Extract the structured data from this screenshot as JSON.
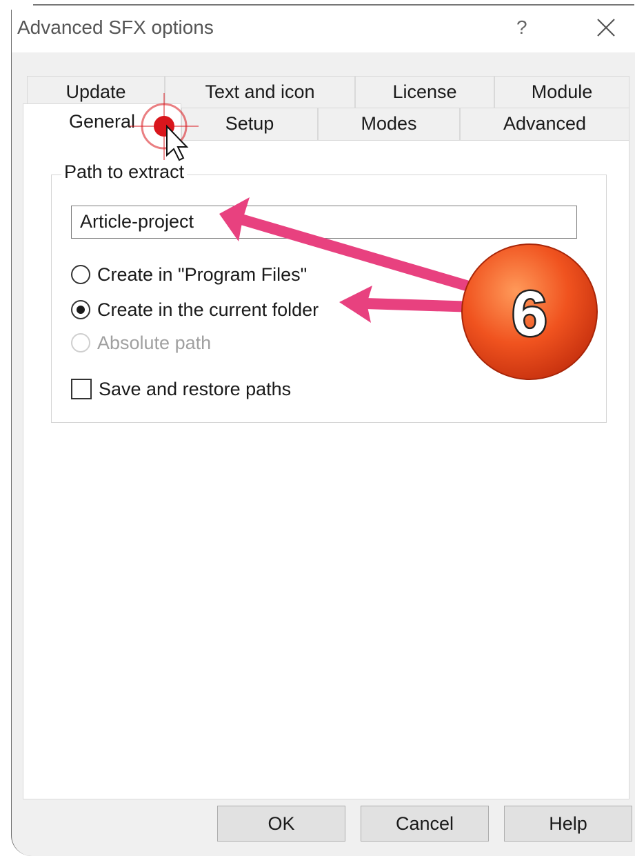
{
  "window": {
    "title": "Advanced SFX options",
    "help_label": "?",
    "close_icon": "close-icon"
  },
  "tabs": {
    "row1": [
      "Update",
      "Text and icon",
      "License",
      "Module"
    ],
    "row2": [
      "General",
      "Setup",
      "Modes",
      "Advanced"
    ],
    "active": "General"
  },
  "path_group": {
    "title": "Path to extract",
    "path_value": "Article-project",
    "options": [
      {
        "label": "Create in \"Program Files\"",
        "checked": false,
        "disabled": false
      },
      {
        "label": "Create in the current folder",
        "checked": true,
        "disabled": false
      },
      {
        "label": "Absolute path",
        "checked": false,
        "disabled": true
      }
    ],
    "save_restore_label": "Save and restore paths",
    "save_restore_checked": false
  },
  "buttons": {
    "ok": "OK",
    "cancel": "Cancel",
    "help": "Help"
  },
  "annotation": {
    "step_number": "6",
    "badge_color": "#e8401c",
    "arrow_color": "#e8417f",
    "click_marker_color": "#d9161c"
  }
}
